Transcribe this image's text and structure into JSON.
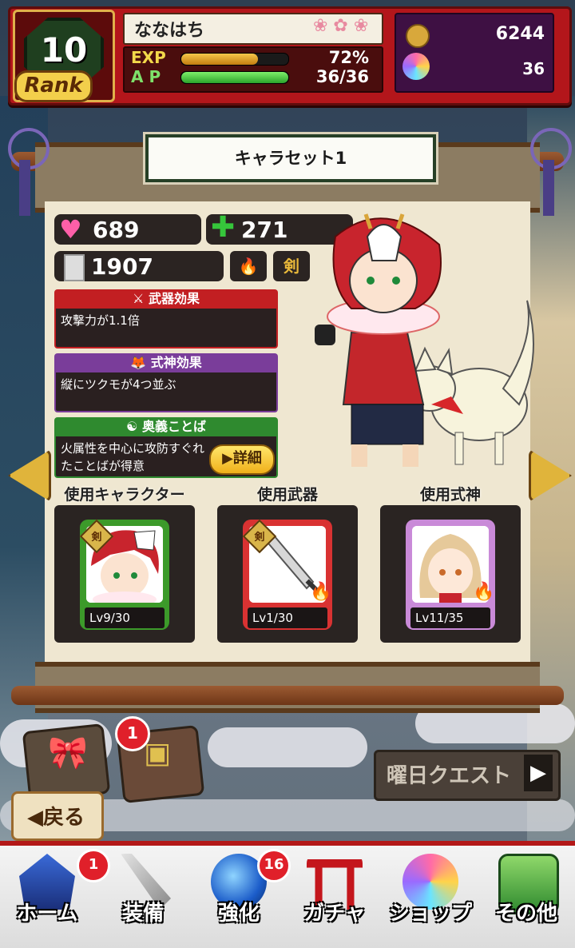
{
  "header": {
    "rank_level": "10",
    "rank_label": "Rank",
    "player_name": "ななはち",
    "exp_label": "EXP",
    "exp_value": "72%",
    "exp_fraction": 0.72,
    "ap_label": "A P",
    "ap_value": "36/36",
    "ap_fraction": 1.0,
    "coins": "6244",
    "spirit_stones": "36"
  },
  "panel": {
    "title": "キャラセット1",
    "hp": "689",
    "heal": "271",
    "attack": "1907",
    "attribute_icon": "fire-icon",
    "weapon_type": "剣",
    "weapon_effect": {
      "title": "武器効果",
      "text": "攻撃力が1.1倍"
    },
    "shikigami_effect": {
      "title": "式神効果",
      "text": "縦にツクモが4つ並ぶ"
    },
    "ougi": {
      "title": "奥義ことば",
      "text": "火属性を中心に攻防すぐれたことばが得意",
      "detail_label": "詳細"
    }
  },
  "slots": [
    {
      "label": "使用キャラクター",
      "level": "Lv9/30",
      "badge": "剣",
      "frame_color": "#3c9a2a"
    },
    {
      "label": "使用武器",
      "level": "Lv1/30",
      "badge": "剣",
      "frame_color": "#d93232"
    },
    {
      "label": "使用式神",
      "level": "Lv11/35",
      "badge": "",
      "frame_color": "#c98ad8"
    }
  ],
  "lower": {
    "present_badge": "1",
    "weekday_quest": "曜日クエスト",
    "back_label": "戻る"
  },
  "nav": [
    {
      "label": "ホーム",
      "badge": "1",
      "icon": "castle-icon"
    },
    {
      "label": "装備",
      "badge": "",
      "icon": "sword-icon"
    },
    {
      "label": "強化",
      "badge": "16",
      "icon": "blue-flame-orb-icon"
    },
    {
      "label": "ガチャ",
      "badge": "",
      "icon": "torii-gate-icon"
    },
    {
      "label": "ショップ",
      "badge": "",
      "icon": "spirit-stone-icon"
    },
    {
      "label": "その他",
      "badge": "",
      "icon": "scroll-icon"
    }
  ],
  "colors": {
    "accent_red": "#b3161b",
    "exp": "#e0a020",
    "ap": "#3cc93c",
    "purple_panel": "#3e1043"
  }
}
